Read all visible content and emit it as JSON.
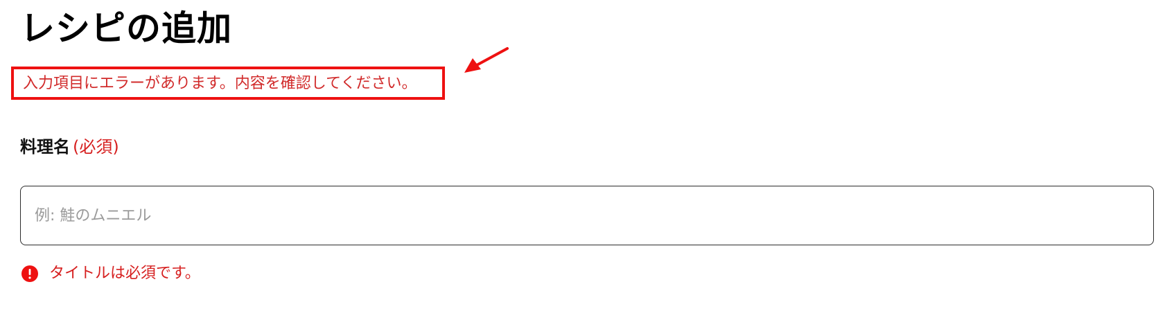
{
  "page": {
    "title": "レシピの追加"
  },
  "error_summary": {
    "message": "入力項目にエラーがあります。内容を確認してください。"
  },
  "form": {
    "title_field": {
      "label": "料理名",
      "required_marker": "(必須)",
      "value": "",
      "placeholder": "例: 鮭のムニエル",
      "error_message": "タイトルは必須です。"
    }
  },
  "icons": {
    "error_icon": "alert-circle-icon",
    "annotation": "arrow-pointer-icon"
  },
  "colors": {
    "error_text": "#d61f1f",
    "annotation_red": "#ee1111",
    "input_border": "#2b2b2b",
    "placeholder": "#9a9a9a"
  }
}
